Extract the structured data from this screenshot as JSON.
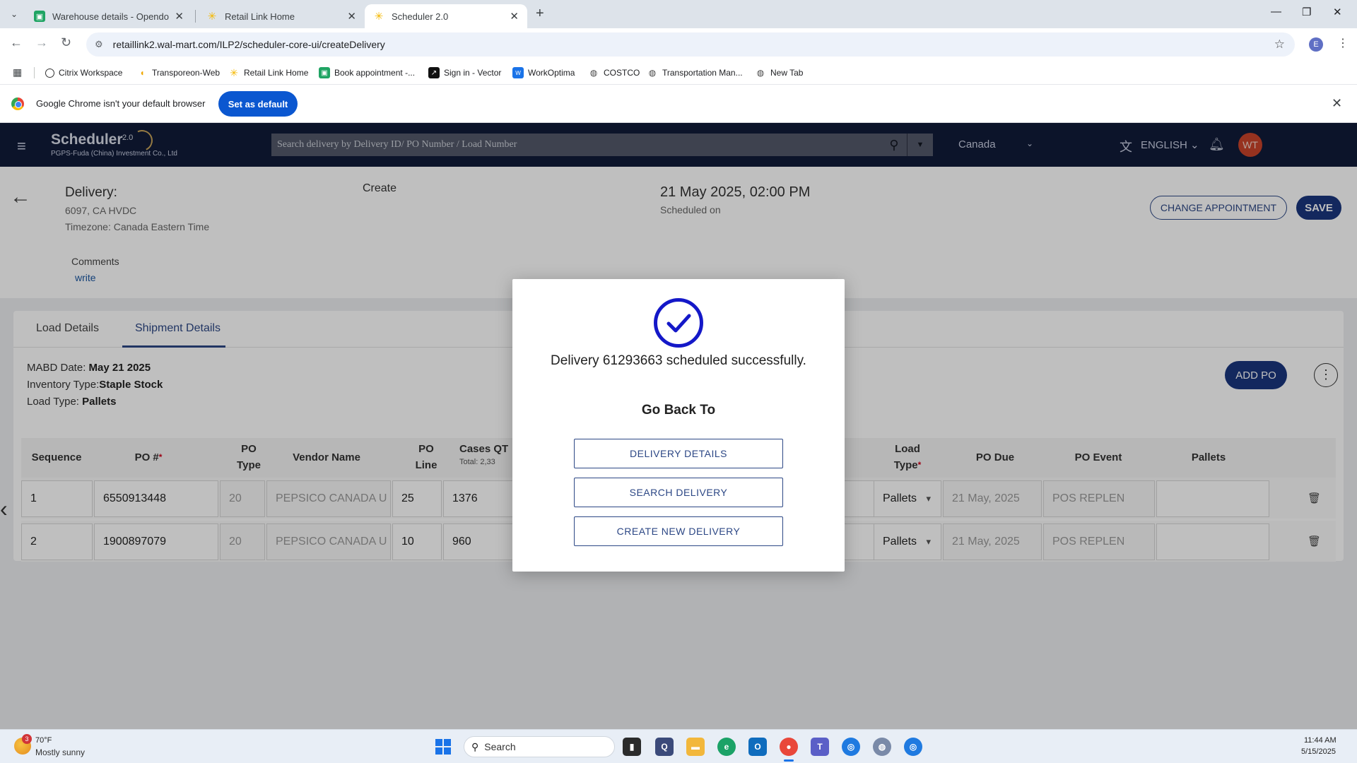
{
  "browser": {
    "tabs": [
      {
        "title": "Warehouse details - Opendock",
        "icon": "opendock-icon"
      },
      {
        "title": "Retail Link Home",
        "icon": "walmart-spark-icon"
      },
      {
        "title": "Scheduler 2.0",
        "icon": "walmart-spark-icon",
        "active": true
      }
    ],
    "url": "retaillink2.wal-mart.com/ILP2/scheduler-core-ui/createDelivery",
    "profile_initial": "E",
    "bookmarks": [
      {
        "label": "Citrix Workspace",
        "icon": "citrix-icon"
      },
      {
        "label": "Transporeon-Web",
        "icon": "transporeon-icon"
      },
      {
        "label": "Retail Link Home",
        "icon": "walmart-spark-icon"
      },
      {
        "label": "Book appointment -...",
        "icon": "opendock-icon"
      },
      {
        "label": "Sign in - Vector",
        "icon": "vector-icon"
      },
      {
        "label": "WorkOptima",
        "icon": "workoptima-icon"
      },
      {
        "label": "COSTCO",
        "icon": "globe-icon"
      },
      {
        "label": "Transportation Man...",
        "icon": "globe-icon"
      },
      {
        "label": "New Tab",
        "icon": "globe-icon"
      }
    ],
    "infobar": {
      "message": "Google Chrome isn't your default browser",
      "button": "Set as default"
    }
  },
  "header": {
    "app_name": "Scheduler",
    "version": "2.0",
    "company": "PGPS-Fuda (China) Investment Co., Ltd",
    "search_placeholder": "Search delivery by Delivery ID/ PO Number / Load Number",
    "country": "Canada",
    "language": "ENGLISH",
    "user_initials": "WT"
  },
  "delivery": {
    "label": "Delivery:",
    "site": "6097, CA HVDC",
    "timezone": "Timezone: Canada Eastern Time",
    "mode": "Create",
    "scheduled_date": "21 May 2025, 02:00 PM",
    "scheduled_label": "Scheduled on",
    "change_button": "CHANGE APPOINTMENT",
    "save_button": "SAVE",
    "comments_label": "Comments",
    "comments_link": "write"
  },
  "tabs": {
    "load_details": "Load Details",
    "shipment_details": "Shipment Details"
  },
  "shipment": {
    "mabd_label": "MABD Date: ",
    "mabd_value": "May 21 2025",
    "inventory_label": "Inventory Type:",
    "inventory_value": "Staple Stock",
    "load_type_label": "Load Type: ",
    "load_type_value": "Pallets",
    "add_po": "ADD PO"
  },
  "table": {
    "headers": {
      "sequence": "Sequence",
      "po_number": "PO #",
      "po_type": "PO Type",
      "vendor_name": "Vendor Name",
      "po_line": "PO Line",
      "cases_qty": "Cases QT",
      "cases_total": "Total: 2,33",
      "load_type": "Load Type",
      "po_due": "PO Due",
      "po_event": "PO Event",
      "pallets": "Pallets"
    },
    "rows": [
      {
        "sequence": "1",
        "po_number": "6550913448",
        "po_type": "20",
        "vendor": "PEPSICO CANADA U",
        "po_line": "25",
        "cases": "1376",
        "load_type": "Pallets",
        "po_due": "21 May, 2025",
        "po_event": "POS REPLEN",
        "pallets": ""
      },
      {
        "sequence": "2",
        "po_number": "1900897079",
        "po_type": "20",
        "vendor": "PEPSICO CANADA U",
        "po_line": "10",
        "cases": "960",
        "load_type": "Pallets",
        "po_due": "21 May, 2025",
        "po_event": "POS REPLEN",
        "pallets": ""
      }
    ]
  },
  "modal": {
    "message": "Delivery 61293663 scheduled successfully.",
    "go_back": "Go Back To",
    "buttons": [
      "DELIVERY DETAILS",
      "SEARCH DELIVERY",
      "CREATE NEW DELIVERY"
    ],
    "icon": "check-circle-icon",
    "accent": "#1418c8"
  },
  "taskbar": {
    "weather_badge": "3",
    "temperature": "70°F",
    "weather": "Mostly sunny",
    "search": "Search",
    "time": "11:44 AM",
    "date": "5/15/2025"
  },
  "colors": {
    "header_bg": "#101b39",
    "primary": "#1a367e",
    "chrome_blue": "#0b57d0"
  }
}
